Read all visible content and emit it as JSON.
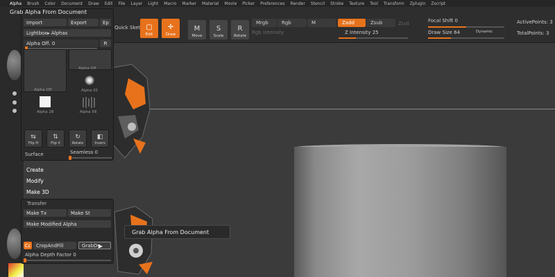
{
  "menu": [
    "Alpha",
    "Brush",
    "Color",
    "Document",
    "Draw",
    "Edit",
    "File",
    "Layer",
    "Light",
    "Macro",
    "Marker",
    "Material",
    "Movie",
    "Picker",
    "Preferences",
    "Render",
    "Stencil",
    "Stroke",
    "Texture",
    "Tool",
    "Transform",
    "Zplugin",
    "Zscript"
  ],
  "toolbar": {
    "quick_sketch": "Quick Sketch",
    "edit": "Edit",
    "draw": "Draw",
    "move": "Move",
    "scale": "Scale",
    "rotate": "Rotate",
    "mrgb": "Mrgb",
    "rgb": "Rgb",
    "m": "M",
    "zadd": "Zadd",
    "zsub": "Zsub",
    "zcut": "Zcut",
    "rgb_intensity": "Rgb Intensity",
    "z_intensity": "Z Intensity 25",
    "focal_shift": "Focal Shift 0",
    "draw_size": "Draw Size 64",
    "dynamic": "Dynamic",
    "active_points": "ActivePoints: 3",
    "total_points": "TotalPoints: 3",
    "z_intensity_level": 0.25,
    "focal_shift_level": 0.5,
    "draw_size_level": 0.3
  },
  "palette": {
    "title": "Grab Alpha From Document",
    "import": "Import",
    "export": "Export",
    "ep": "Ep",
    "lightbox": "Lightbox▸ Alphas",
    "alpha_off_slider": "Alpha Off. 0",
    "r": "R",
    "thumb_big": "Alpha Off",
    "thumb_small": "Alpha Off",
    "alpha01": "Alpha 01",
    "alpha28": "Alpha 28",
    "alpha58": "Alpha 58",
    "flip_h": "Flip H",
    "flip_v": "Flip V",
    "rotate": "Rotate",
    "invers": "Invers",
    "surface": "Surface",
    "seamless": "Seamless 0"
  },
  "sub": {
    "create": "Create",
    "modify": "Modify",
    "make3d": "Make 3D",
    "transfer": "Transfer",
    "make_tx": "Make Tx",
    "make_st": "Make St",
    "make_modified_alpha": "Make Modified Alpha",
    "cc": "Cc",
    "crop_and_fill": "CropAndFill",
    "grabdoc": "GrabDo",
    "alpha_depth_factor": "Alpha Depth Factor 0"
  },
  "tooltip": "Grab Alpha From Document",
  "colors": {
    "accent": "#e8721c",
    "panel": "#2b2b2b",
    "canvas": "#3b3b3b"
  }
}
